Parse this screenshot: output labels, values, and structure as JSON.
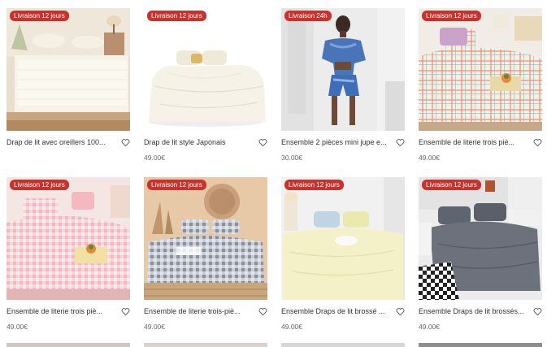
{
  "products": [
    {
      "badge": "Livraison 12 jours",
      "title": "Drap de lit avec oreillers 100...",
      "price": "",
      "image": "white-quilted-mattress-cover"
    },
    {
      "badge": "Livraison 12 jours",
      "title": "Drap de lit style Japonais",
      "price": "49.00€",
      "image": "white-duvet-bedding"
    },
    {
      "badge": "Livraison 24h",
      "title": "Ensemble 2 pièces mini jupe e...",
      "price": "30.00€",
      "image": "blue-tie-dye-two-piece-outfit"
    },
    {
      "badge": "Livraison 12 jours",
      "title": "Ensemble de literie trois piè...",
      "price": "49.00€",
      "image": "plaid-orange-bedding-set"
    },
    {
      "badge": "Livraison 12 jours",
      "title": "Ensemble de literie trois piè...",
      "price": "49.00€",
      "image": "pink-gingham-bedding-set"
    },
    {
      "badge": "Livraison 12 jours",
      "title": "Ensemble de literie trois-piè...",
      "price": "49.00€",
      "image": "gray-gingham-bedding-set"
    },
    {
      "badge": "Livraison 12 jours",
      "title": "Ensemble Draps de lit brossé ...",
      "price": "49.00€",
      "image": "cream-brushed-bedding-set"
    },
    {
      "badge": "Livraison 12 jours",
      "title": "Ensemble Draps de lit brossés...",
      "price": "49.00€",
      "image": "dark-gray-brushed-bedding-set"
    }
  ],
  "icons": {
    "wishlist": "heart-outline-icon"
  },
  "colors": {
    "badge": "#c8322d",
    "text": "#333333",
    "price": "#666666"
  }
}
